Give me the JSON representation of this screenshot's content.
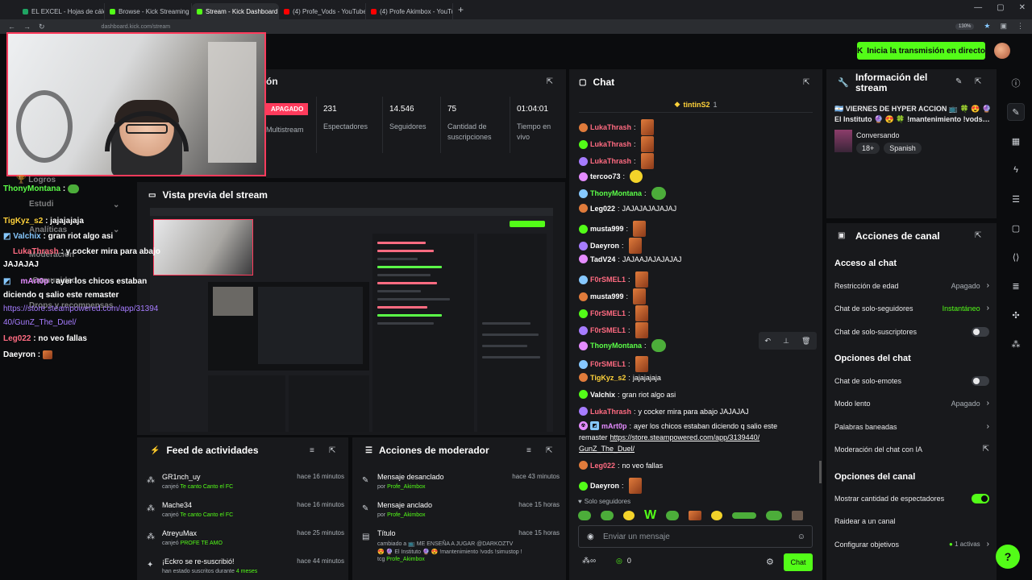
{
  "browser": {
    "tabs": [
      {
        "label": "EL EXCEL - Hojas de cálculo de",
        "color": "#1fa463"
      },
      {
        "label": "Browse - Kick Streaming",
        "color": "#53fc18"
      },
      {
        "label": "Stream - Kick Dashboard",
        "color": "#53fc18"
      },
      {
        "label": "(4) Profe_Vods - YouTube",
        "color": "#ff0000"
      },
      {
        "label": "(4) Profe Akimbox - YouTube",
        "color": "#ff0000"
      }
    ],
    "url": "dashboard.kick.com/stream",
    "zoom": "130%"
  },
  "header": {
    "go_live_label": "Inicia la transmisión en directo"
  },
  "stats": {
    "title_partial": "ón",
    "status": "APAGADO",
    "multistream_label": "Multistream",
    "items": [
      {
        "value": "231",
        "label": "Espectadores"
      },
      {
        "value": "14.546",
        "label": "Seguidores"
      },
      {
        "value": "75",
        "label": "Cantidad de suscripciones"
      },
      {
        "value": "01:04:01",
        "label": "Tiempo en vivo"
      }
    ]
  },
  "overlay": {
    "lines": [
      {
        "name": "ThonyMontana",
        "name_color": "#5bff48",
        "text": " :"
      },
      {
        "name": "TigKyz_s2",
        "name_color": "#ffd23a",
        "text": " : jajajajaja"
      },
      {
        "name": "Valchix",
        "name_color": "#86c8ff",
        "text": " : gran riot algo asi"
      },
      {
        "name": "LukaThrash",
        "name_color": "#ff6b81",
        "text": " : y cocker mira para abajo"
      },
      {
        "name": "",
        "name_color": "#fff",
        "text": "JAJAJAJ"
      },
      {
        "name": "mArt0p",
        "name_color": "#e58cff",
        "text": " : ayer los chicos estaban"
      },
      {
        "name": "",
        "name_color": "#fff",
        "text": "diciendo q salio este remaster"
      },
      {
        "name": "",
        "name_color": "#a67cff",
        "text": "https://store.steampowered.com/app/31394"
      },
      {
        "name": "",
        "name_color": "#a67cff",
        "text": "40/GunZ_The_Duel/"
      },
      {
        "name": "Leg022",
        "name_color": "#ff6b81",
        "text": " : no veo fallas"
      },
      {
        "name": "Daeyron",
        "name_color": "#fff",
        "text": " :"
      }
    ],
    "ghost_menu": [
      "Logros",
      "Estudi",
      "Analíticas",
      "Moderación",
      "Comunidad",
      "Drops y recompensas"
    ]
  },
  "preview": {
    "title": "Vista previa del stream"
  },
  "feed": {
    "title": "Feed de actividades",
    "items": [
      {
        "name": "GR1nch_uy",
        "action": "canjeó ",
        "reward": "Te canto Canto el FC",
        "time": "hace 16 minutos"
      },
      {
        "name": "Mache34",
        "action": "canjeó ",
        "reward": "Te canto Canto el FC",
        "time": "hace 16 minutos"
      },
      {
        "name": "AtreyuMax",
        "action": "canjeó ",
        "reward": "PROFE TE AMO",
        "time": "hace 25 minutos"
      },
      {
        "name": "¡Eckro se re-suscribió!",
        "action": "han estado suscritos durante ",
        "reward": "4 meses",
        "time": "hace 44 minutos"
      }
    ]
  },
  "mod": {
    "title": "Acciones de moderador",
    "items": [
      {
        "title": "Mensaje desanclado",
        "by": "por ",
        "user": "Profe_Akimbox",
        "time": "hace 43 minutos"
      },
      {
        "title": "Mensaje anclado",
        "by": "por ",
        "user": "Profe_Akimbox",
        "time": "hace 15 horas"
      },
      {
        "title": "Título",
        "by": "cambiado a 📺 ME ENSEÑA A JUGAR @DARKOZTV",
        "user": "",
        "time": "hace 15 horas"
      }
    ],
    "title_line2": "😍 🔮 El Instituto 🔮 😍 !mantenimiento !vods !simustop !",
    "title_line3": "tcg ",
    "title_user": "Profe_Akimbox"
  },
  "chat": {
    "title": "Chat",
    "pinned_user": "tintinS2",
    "pinned_count": "1",
    "messages": [
      {
        "user": "LukaThrash",
        "cls": "nm-red",
        "text": "",
        "emote": "tall"
      },
      {
        "user": "LukaThrash",
        "cls": "nm-red",
        "text": "",
        "emote": "tall"
      },
      {
        "user": "LukaThrash",
        "cls": "nm-red",
        "text": "",
        "emote": "tall"
      },
      {
        "user": "tercoo73",
        "cls": "nm-wht",
        "text": "",
        "emote": "yel"
      },
      {
        "user": "ThonyMontana",
        "cls": "nm-grn",
        "text": "",
        "emote": "frog"
      },
      {
        "user": "Leg022",
        "cls": "nm-wht",
        "text": " JAJAJAJAJAJAJ",
        "emote": ""
      },
      {
        "user": "musta999",
        "cls": "nm-wht",
        "text": "",
        "emote": "tall"
      },
      {
        "user": "Daeyron",
        "cls": "nm-wht",
        "text": "",
        "emote": "tall"
      },
      {
        "user": "TadV24",
        "cls": "nm-wht",
        "text": " JAJAAJAJAJAJAJ",
        "emote": ""
      },
      {
        "user": "F0rSMEL1",
        "cls": "nm-red",
        "text": "",
        "emote": "tall"
      },
      {
        "user": "musta999",
        "cls": "nm-wht",
        "text": "",
        "emote": "tall"
      },
      {
        "user": "F0rSMEL1",
        "cls": "nm-red",
        "text": "",
        "emote": "tall"
      },
      {
        "user": "F0rSMEL1",
        "cls": "nm-red",
        "text": "",
        "emote": "tall"
      },
      {
        "user": "ThonyMontana",
        "cls": "nm-grn",
        "text": "",
        "emote": "frog"
      },
      {
        "user": "F0rSMEL1",
        "cls": "nm-red",
        "text": "",
        "emote": "tall"
      },
      {
        "user": "TigKyz_s2",
        "cls": "nm-yel",
        "text": " jajajajaja",
        "emote": ""
      },
      {
        "user": "Valchix",
        "cls": "nm-wht",
        "text": " gran riot algo asi",
        "emote": ""
      },
      {
        "user": "LukaThrash",
        "cls": "nm-red",
        "text": " y cocker mira para abajo JAJAJAJ",
        "emote": ""
      }
    ],
    "long_user": "mArt0p",
    "long_text": " ayer los chicos estaban diciendo q salio este",
    "long_text2": "remaster ",
    "long_link": "https://store.steampowered.com/app/3139440/",
    "long_link2": "GunZ_The_Duel/",
    "after": [
      {
        "user": "Leg022",
        "cls": "nm-red",
        "text": " no veo fallas",
        "emote": ""
      },
      {
        "user": "Daeyron",
        "cls": "nm-wht",
        "text": "",
        "emote": "tall"
      }
    ],
    "followers_only": "Solo seguidores",
    "input_placeholder": "Enviar un mensaje",
    "points": "0",
    "send_label": "Chat"
  },
  "info": {
    "title": "Información del stream",
    "stream_title_line1": "🇦🇷 VIERNES DE HYPER ACCION 📺 🍀 😍 🔮",
    "stream_title_line2": "El Instituto 🔮 😍 🍀 !mantenimiento !vods…",
    "category": "Conversando",
    "tags": [
      "18+",
      "Spanish"
    ]
  },
  "actions": {
    "title": "Acciones de canal",
    "chat_access": "Acceso al chat",
    "age": {
      "label": "Restricción de edad",
      "value": "Apagado"
    },
    "followers": {
      "label": "Chat de solo-seguidores",
      "value": "Instantáneo"
    },
    "subs": {
      "label": "Chat de solo-suscriptores"
    },
    "chat_options": "Opciones del chat",
    "emotes": {
      "label": "Chat de solo-emotes"
    },
    "slow": {
      "label": "Modo lento",
      "value": "Apagado"
    },
    "banned": {
      "label": "Palabras baneadas"
    },
    "ai": {
      "label": "Moderación del chat con IA"
    },
    "channel_options": "Opciones del canal",
    "viewers": {
      "label": "Mostrar cantidad de espectadores"
    },
    "raid": {
      "label": "Raidear a un canal"
    },
    "goals": {
      "label": "Configurar objetivos",
      "value": "1 activas"
    }
  }
}
